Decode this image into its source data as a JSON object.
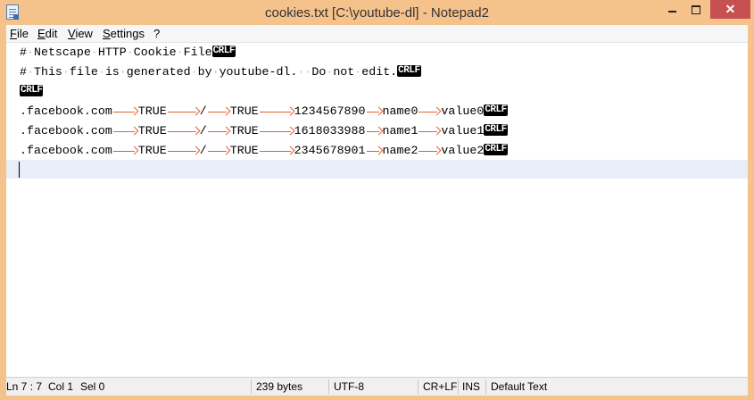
{
  "window": {
    "title": "cookies.txt [C:\\youtube-dl] - Notepad2",
    "close_label": "✕"
  },
  "menu": [
    "File",
    "Edit",
    "View",
    "Settings",
    "?"
  ],
  "editor": {
    "eol_marker": "CRLF",
    "header_lines": [
      "# Netscape HTTP Cookie File",
      "# This file is generated by youtube-dl.  Do not edit."
    ],
    "rows": [
      [
        ".facebook.com",
        "TRUE",
        "/",
        "TRUE",
        "1234567890",
        "name0",
        "value0"
      ],
      [
        ".facebook.com",
        "TRUE",
        "/",
        "TRUE",
        "1618033988",
        "name1",
        "value1"
      ],
      [
        ".facebook.com",
        "TRUE",
        "/",
        "TRUE",
        "2345678901",
        "name2",
        "value2"
      ]
    ]
  },
  "status": {
    "position": "Ln 7 : 7",
    "column": "Col 1",
    "selection": "Sel 0",
    "size": "239 bytes",
    "encoding": "UTF-8",
    "line_endings": "CR+LF",
    "insert_mode": "INS",
    "scheme": "Default Text"
  }
}
